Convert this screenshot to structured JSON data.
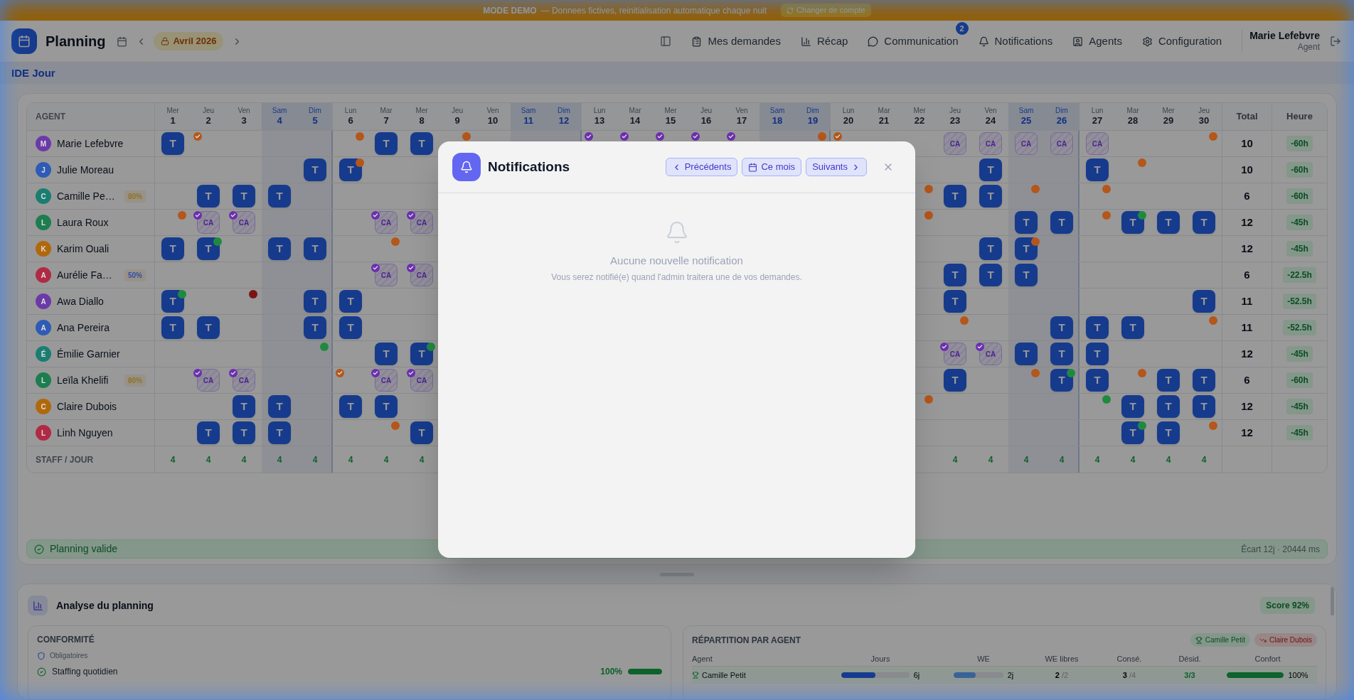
{
  "banner": {
    "label": "MODE DEMO",
    "message": "— Donnees fictives, reinitialisation automatique chaque nuit",
    "button": "Changer de compte"
  },
  "header": {
    "title": "Planning",
    "month": "Avril 2026",
    "nav": [
      {
        "label": "Mes demandes",
        "kind": "requests"
      },
      {
        "label": "Récap",
        "kind": "recap"
      },
      {
        "label": "Communication",
        "kind": "chat",
        "badge": "2"
      },
      {
        "label": "Notifications",
        "kind": "bell"
      },
      {
        "label": "Agents",
        "kind": "agents"
      },
      {
        "label": "Configuration",
        "kind": "settings"
      }
    ],
    "user": {
      "name": "Marie Lefebvre",
      "role": "Agent"
    }
  },
  "team": "IDE Jour",
  "table": {
    "agent_heading": "AGENT",
    "total_heading": "Total",
    "hours_heading": "Heure",
    "footer_label": "STAFF / JOUR",
    "days": [
      {
        "weekday": "Mer",
        "day": "1",
        "weekend": false,
        "staff": "4"
      },
      {
        "weekday": "Jeu",
        "day": "2",
        "weekend": false,
        "staff": "4"
      },
      {
        "weekday": "Ven",
        "day": "3",
        "weekend": false,
        "staff": "4"
      },
      {
        "weekday": "Sam",
        "day": "4",
        "weekend": true,
        "staff": "4"
      },
      {
        "weekday": "Dim",
        "day": "5",
        "weekend": true,
        "staff": "4"
      },
      {
        "weekday": "Lun",
        "day": "6",
        "weekend": false,
        "staff": "4"
      },
      {
        "weekday": "Mar",
        "day": "7",
        "weekend": false,
        "staff": "4"
      },
      {
        "weekday": "Mer",
        "day": "8",
        "weekend": false,
        "staff": "4"
      },
      {
        "weekday": "Jeu",
        "day": "9",
        "weekend": false
      },
      {
        "weekday": "Ven",
        "day": "10",
        "weekend": false
      },
      {
        "weekday": "Sam",
        "day": "11",
        "weekend": true
      },
      {
        "weekday": "Dim",
        "day": "12",
        "weekend": true
      },
      {
        "weekday": "Lun",
        "day": "13",
        "weekend": false
      },
      {
        "weekday": "Mar",
        "day": "14",
        "weekend": false
      },
      {
        "weekday": "Mer",
        "day": "15",
        "weekend": false
      },
      {
        "weekday": "Jeu",
        "day": "16",
        "weekend": false
      },
      {
        "weekday": "Ven",
        "day": "17",
        "weekend": false
      },
      {
        "weekday": "Sam",
        "day": "18",
        "weekend": true
      },
      {
        "weekday": "Dim",
        "day": "19",
        "weekend": true
      },
      {
        "weekday": "Lun",
        "day": "20",
        "weekend": false
      },
      {
        "weekday": "Mar",
        "day": "21",
        "weekend": false
      },
      {
        "weekday": "Mer",
        "day": "22",
        "weekend": false
      },
      {
        "weekday": "Jeu",
        "day": "23",
        "weekend": false,
        "staff": "4"
      },
      {
        "weekday": "Ven",
        "day": "24",
        "weekend": false,
        "staff": "4"
      },
      {
        "weekday": "Sam",
        "day": "25",
        "weekend": true,
        "staff": "4"
      },
      {
        "weekday": "Dim",
        "day": "26",
        "weekend": true,
        "staff": "4"
      },
      {
        "weekday": "Lun",
        "day": "27",
        "weekend": false,
        "staff": "4"
      },
      {
        "weekday": "Mar",
        "day": "28",
        "weekend": false,
        "staff": "4"
      },
      {
        "weekday": "Mer",
        "day": "29",
        "weekend": false,
        "staff": "4"
      },
      {
        "weekday": "Jeu",
        "day": "30",
        "weekend": false,
        "staff": "4"
      }
    ],
    "rows": [
      {
        "initial": "M",
        "color": "#6b3aa8",
        "name": "Marie Lefebvre",
        "total": "10",
        "hours": "-60h",
        "cells": [
          {
            "kind": "shift",
            "label": "T"
          },
          {
            "kind": "empty",
            "marker": {
              "color": "#b5561a",
              "check": true
            }
          },
          {
            "kind": "empty"
          },
          {
            "kind": "empty"
          },
          {
            "kind": "empty"
          },
          {
            "kind": "empty",
            "marker": {
              "color": "#b5561a",
              "check": false
            }
          },
          {
            "kind": "shift",
            "label": "T"
          },
          {
            "kind": "shift",
            "label": "T"
          },
          {
            "kind": "empty",
            "marker": {
              "color": "#b5561a",
              "check": false
            }
          },
          {
            "kind": "empty"
          },
          {
            "kind": "empty"
          },
          {
            "kind": "empty"
          },
          {
            "kind": "empty",
            "marker": {
              "color": "#6b2fb0",
              "check": true
            }
          },
          {
            "kind": "empty",
            "marker": {
              "color": "#6b2fb0",
              "check": true
            }
          },
          {
            "kind": "empty",
            "marker": {
              "color": "#6b2fb0",
              "check": true
            }
          },
          {
            "kind": "empty",
            "marker": {
              "color": "#6b2fb0",
              "check": true
            }
          },
          {
            "kind": "empty",
            "marker": {
              "color": "#6b2fb0",
              "check": true
            }
          },
          {
            "kind": "empty"
          },
          {
            "kind": "empty",
            "marker": {
              "color": "#b5561a",
              "check": false
            }
          },
          {
            "kind": "empty",
            "marker": {
              "color": "#b5561a",
              "check": true
            }
          },
          {
            "kind": "empty"
          },
          {
            "kind": "empty"
          },
          {
            "kind": "leave",
            "label": "CA"
          },
          {
            "kind": "leave",
            "label": "CA"
          },
          {
            "kind": "leave",
            "label": "CA"
          },
          {
            "kind": "leave",
            "label": "CA"
          },
          {
            "kind": "leave",
            "label": "CA"
          },
          {
            "kind": "empty"
          },
          {
            "kind": "empty"
          },
          {
            "kind": "empty",
            "marker": {
              "color": "#b5561a",
              "check": false
            }
          }
        ]
      },
      {
        "initial": "J",
        "color": "#2e5bb5",
        "name": "Julie Moreau",
        "total": "10",
        "hours": "-60h",
        "cells": [
          {
            "kind": "empty"
          },
          {
            "kind": "empty"
          },
          {
            "kind": "empty"
          },
          {
            "kind": "empty"
          },
          {
            "kind": "shift",
            "label": "T"
          },
          {
            "kind": "shift",
            "label": "T",
            "marker": {
              "color": "#b5561a",
              "check": false
            }
          },
          {
            "kind": "empty"
          },
          {
            "kind": "empty"
          },
          {
            "kind": "empty"
          },
          {
            "kind": "empty"
          },
          {
            "kind": "empty"
          },
          {
            "kind": "empty"
          },
          {
            "kind": "empty"
          },
          {
            "kind": "empty"
          },
          {
            "kind": "empty"
          },
          {
            "kind": "empty"
          },
          {
            "kind": "empty"
          },
          {
            "kind": "empty"
          },
          {
            "kind": "empty"
          },
          {
            "kind": "empty"
          },
          {
            "kind": "empty"
          },
          {
            "kind": "empty"
          },
          {
            "kind": "empty"
          },
          {
            "kind": "shift",
            "label": "T"
          },
          {
            "kind": "empty"
          },
          {
            "kind": "empty"
          },
          {
            "kind": "shift",
            "label": "T"
          },
          {
            "kind": "empty",
            "marker": {
              "color": "#b5561a",
              "check": false
            }
          },
          {
            "kind": "empty"
          },
          {
            "kind": "empty"
          }
        ]
      },
      {
        "initial": "C",
        "color": "#1a7d72",
        "name": "Camille Pe…",
        "badge": {
          "label": "80%",
          "color": "#8f7425"
        },
        "total": "6",
        "hours": "-60h",
        "cells": [
          {
            "kind": "empty"
          },
          {
            "kind": "shift",
            "label": "T"
          },
          {
            "kind": "shift",
            "label": "T"
          },
          {
            "kind": "shift",
            "label": "T"
          },
          {
            "kind": "empty"
          },
          {
            "kind": "empty"
          },
          {
            "kind": "empty"
          },
          {
            "kind": "empty"
          },
          {
            "kind": "empty"
          },
          {
            "kind": "empty"
          },
          {
            "kind": "empty"
          },
          {
            "kind": "empty"
          },
          {
            "kind": "empty"
          },
          {
            "kind": "empty"
          },
          {
            "kind": "empty"
          },
          {
            "kind": "empty"
          },
          {
            "kind": "empty"
          },
          {
            "kind": "empty"
          },
          {
            "kind": "empty"
          },
          {
            "kind": "empty"
          },
          {
            "kind": "empty"
          },
          {
            "kind": "empty",
            "marker": {
              "color": "#b5561a",
              "check": false
            }
          },
          {
            "kind": "shift",
            "label": "T"
          },
          {
            "kind": "shift",
            "label": "T"
          },
          {
            "kind": "empty",
            "marker": {
              "color": "#b5561a",
              "check": false
            }
          },
          {
            "kind": "empty"
          },
          {
            "kind": "empty",
            "marker": {
              "color": "#b5561a",
              "check": false
            }
          },
          {
            "kind": "empty"
          },
          {
            "kind": "empty"
          },
          {
            "kind": "empty"
          }
        ]
      },
      {
        "initial": "L",
        "color": "#1d7d4f",
        "name": "Laura Roux",
        "total": "12",
        "hours": "-45h",
        "cells": [
          {
            "kind": "empty",
            "marker": {
              "color": "#b5561a",
              "check": false
            }
          },
          {
            "kind": "leave",
            "label": "CA",
            "marker": {
              "color": "#6b2fb0",
              "check": true
            }
          },
          {
            "kind": "leave",
            "label": "CA",
            "marker": {
              "color": "#6b2fb0",
              "check": true
            }
          },
          {
            "kind": "empty"
          },
          {
            "kind": "empty"
          },
          {
            "kind": "empty"
          },
          {
            "kind": "leave",
            "label": "CA",
            "marker": {
              "color": "#6b2fb0",
              "check": true
            }
          },
          {
            "kind": "leave",
            "label": "CA",
            "marker": {
              "color": "#6b2fb0",
              "check": true
            }
          },
          {
            "kind": "empty"
          },
          {
            "kind": "empty"
          },
          {
            "kind": "empty"
          },
          {
            "kind": "empty"
          },
          {
            "kind": "empty"
          },
          {
            "kind": "empty"
          },
          {
            "kind": "empty"
          },
          {
            "kind": "empty"
          },
          {
            "kind": "empty"
          },
          {
            "kind": "empty"
          },
          {
            "kind": "empty"
          },
          {
            "kind": "empty"
          },
          {
            "kind": "empty"
          },
          {
            "kind": "empty",
            "marker": {
              "color": "#b5561a",
              "check": false
            }
          },
          {
            "kind": "empty"
          },
          {
            "kind": "empty"
          },
          {
            "kind": "shift",
            "label": "T"
          },
          {
            "kind": "shift",
            "label": "T"
          },
          {
            "kind": "empty",
            "marker": {
              "color": "#b5561a",
              "check": false
            }
          },
          {
            "kind": "shift",
            "label": "T",
            "marker": {
              "color": "#1f8a3e",
              "check": false
            }
          },
          {
            "kind": "shift",
            "label": "T"
          },
          {
            "kind": "shift",
            "label": "T"
          }
        ]
      },
      {
        "initial": "K",
        "color": "#b0680c",
        "name": "Karim Ouali",
        "total": "12",
        "hours": "-45h",
        "cells": [
          {
            "kind": "shift",
            "label": "T"
          },
          {
            "kind": "shift",
            "label": "T",
            "marker": {
              "color": "#1f8a3e",
              "check": false
            }
          },
          {
            "kind": "empty"
          },
          {
            "kind": "shift",
            "label": "T"
          },
          {
            "kind": "shift",
            "label": "T"
          },
          {
            "kind": "empty"
          },
          {
            "kind": "empty",
            "marker": {
              "color": "#b5561a",
              "check": false
            }
          },
          {
            "kind": "empty"
          },
          {
            "kind": "empty"
          },
          {
            "kind": "empty"
          },
          {
            "kind": "empty"
          },
          {
            "kind": "empty"
          },
          {
            "kind": "empty"
          },
          {
            "kind": "empty"
          },
          {
            "kind": "empty"
          },
          {
            "kind": "empty"
          },
          {
            "kind": "empty"
          },
          {
            "kind": "empty"
          },
          {
            "kind": "empty"
          },
          {
            "kind": "empty"
          },
          {
            "kind": "empty"
          },
          {
            "kind": "empty"
          },
          {
            "kind": "empty"
          },
          {
            "kind": "shift",
            "label": "T"
          },
          {
            "kind": "shift",
            "label": "T",
            "marker": {
              "color": "#b5561a",
              "check": false
            }
          },
          {
            "kind": "empty"
          },
          {
            "kind": "empty"
          },
          {
            "kind": "empty"
          },
          {
            "kind": "empty"
          },
          {
            "kind": "empty"
          }
        ]
      },
      {
        "initial": "A",
        "color": "#b02a45",
        "name": "Aurélie Fa…",
        "badge": {
          "label": "50%",
          "color": "#2f4fa5"
        },
        "total": "6",
        "hours": "-22.5h",
        "cells": [
          {
            "kind": "empty"
          },
          {
            "kind": "empty"
          },
          {
            "kind": "empty"
          },
          {
            "kind": "empty"
          },
          {
            "kind": "empty"
          },
          {
            "kind": "empty"
          },
          {
            "kind": "leave",
            "label": "CA",
            "marker": {
              "color": "#6b2fb0",
              "check": true
            }
          },
          {
            "kind": "leave",
            "label": "CA",
            "marker": {
              "color": "#6b2fb0",
              "check": true
            }
          },
          {
            "kind": "empty"
          },
          {
            "kind": "empty"
          },
          {
            "kind": "empty"
          },
          {
            "kind": "empty"
          },
          {
            "kind": "empty"
          },
          {
            "kind": "empty"
          },
          {
            "kind": "empty"
          },
          {
            "kind": "empty"
          },
          {
            "kind": "empty"
          },
          {
            "kind": "empty"
          },
          {
            "kind": "empty"
          },
          {
            "kind": "empty"
          },
          {
            "kind": "empty"
          },
          {
            "kind": "empty"
          },
          {
            "kind": "shift",
            "label": "T"
          },
          {
            "kind": "shift",
            "label": "T"
          },
          {
            "kind": "shift",
            "label": "T"
          },
          {
            "kind": "empty"
          },
          {
            "kind": "empty"
          },
          {
            "kind": "empty"
          },
          {
            "kind": "empty"
          },
          {
            "kind": "empty"
          }
        ]
      },
      {
        "initial": "A",
        "color": "#6b3aa8",
        "name": "Awa Diallo",
        "total": "11",
        "hours": "-52.5h",
        "cells": [
          {
            "kind": "shift",
            "label": "T",
            "marker": {
              "color": "#1f8a3e",
              "check": false
            }
          },
          {
            "kind": "empty"
          },
          {
            "kind": "empty",
            "marker": {
              "color": "#7a1414",
              "check": false
            }
          },
          {
            "kind": "empty"
          },
          {
            "kind": "shift",
            "label": "T"
          },
          {
            "kind": "shift",
            "label": "T"
          },
          {
            "kind": "empty"
          },
          {
            "kind": "empty"
          },
          {
            "kind": "empty"
          },
          {
            "kind": "empty"
          },
          {
            "kind": "empty"
          },
          {
            "kind": "empty"
          },
          {
            "kind": "empty"
          },
          {
            "kind": "empty"
          },
          {
            "kind": "empty"
          },
          {
            "kind": "empty"
          },
          {
            "kind": "empty"
          },
          {
            "kind": "empty"
          },
          {
            "kind": "empty"
          },
          {
            "kind": "empty"
          },
          {
            "kind": "empty"
          },
          {
            "kind": "empty"
          },
          {
            "kind": "shift",
            "label": "T"
          },
          {
            "kind": "empty"
          },
          {
            "kind": "empty"
          },
          {
            "kind": "empty"
          },
          {
            "kind": "empty"
          },
          {
            "kind": "empty"
          },
          {
            "kind": "empty"
          },
          {
            "kind": "shift",
            "label": "T"
          }
        ]
      },
      {
        "initial": "A",
        "color": "#2e5bb5",
        "name": "Ana Pereira",
        "total": "11",
        "hours": "-52.5h",
        "cells": [
          {
            "kind": "shift",
            "label": "T"
          },
          {
            "kind": "shift",
            "label": "T"
          },
          {
            "kind": "empty"
          },
          {
            "kind": "empty"
          },
          {
            "kind": "shift",
            "label": "T"
          },
          {
            "kind": "shift",
            "label": "T"
          },
          {
            "kind": "empty"
          },
          {
            "kind": "empty"
          },
          {
            "kind": "empty"
          },
          {
            "kind": "empty"
          },
          {
            "kind": "empty"
          },
          {
            "kind": "empty"
          },
          {
            "kind": "empty"
          },
          {
            "kind": "empty"
          },
          {
            "kind": "empty"
          },
          {
            "kind": "empty"
          },
          {
            "kind": "empty"
          },
          {
            "kind": "empty"
          },
          {
            "kind": "empty"
          },
          {
            "kind": "empty"
          },
          {
            "kind": "empty"
          },
          {
            "kind": "empty"
          },
          {
            "kind": "empty",
            "marker": {
              "color": "#b5561a",
              "check": false
            }
          },
          {
            "kind": "empty"
          },
          {
            "kind": "empty"
          },
          {
            "kind": "shift",
            "label": "T"
          },
          {
            "kind": "shift",
            "label": "T"
          },
          {
            "kind": "shift",
            "label": "T"
          },
          {
            "kind": "empty"
          },
          {
            "kind": "empty",
            "marker": {
              "color": "#b5561a",
              "check": false
            }
          }
        ]
      },
      {
        "initial": "É",
        "color": "#1a7d72",
        "name": "Émilie Garnier",
        "total": "12",
        "hours": "-45h",
        "cells": [
          {
            "kind": "empty"
          },
          {
            "kind": "empty"
          },
          {
            "kind": "empty"
          },
          {
            "kind": "empty"
          },
          {
            "kind": "empty",
            "marker": {
              "color": "#1f8a3e",
              "check": false
            }
          },
          {
            "kind": "empty"
          },
          {
            "kind": "shift",
            "label": "T"
          },
          {
            "kind": "shift",
            "label": "T",
            "marker": {
              "color": "#1f8a3e",
              "check": false
            }
          },
          {
            "kind": "empty"
          },
          {
            "kind": "empty"
          },
          {
            "kind": "empty"
          },
          {
            "kind": "empty"
          },
          {
            "kind": "empty"
          },
          {
            "kind": "empty"
          },
          {
            "kind": "empty"
          },
          {
            "kind": "empty"
          },
          {
            "kind": "empty"
          },
          {
            "kind": "empty"
          },
          {
            "kind": "empty"
          },
          {
            "kind": "empty"
          },
          {
            "kind": "empty"
          },
          {
            "kind": "empty"
          },
          {
            "kind": "leave",
            "label": "CA",
            "marker": {
              "color": "#6b2fb0",
              "check": true
            }
          },
          {
            "kind": "leave",
            "label": "CA",
            "marker": {
              "color": "#6b2fb0",
              "check": true
            }
          },
          {
            "kind": "shift",
            "label": "T"
          },
          {
            "kind": "shift",
            "label": "T"
          },
          {
            "kind": "shift",
            "label": "T"
          },
          {
            "kind": "empty"
          },
          {
            "kind": "empty"
          },
          {
            "kind": "empty"
          }
        ]
      },
      {
        "initial": "L",
        "color": "#1d7d4f",
        "name": "Leïla Khelifi",
        "badge": {
          "label": "80%",
          "color": "#8f7425"
        },
        "total": "6",
        "hours": "-60h",
        "cells": [
          {
            "kind": "empty"
          },
          {
            "kind": "leave",
            "label": "CA",
            "marker": {
              "color": "#6b2fb0",
              "check": true
            }
          },
          {
            "kind": "leave",
            "label": "CA",
            "marker": {
              "color": "#6b2fb0",
              "check": true
            }
          },
          {
            "kind": "empty"
          },
          {
            "kind": "empty"
          },
          {
            "kind": "empty",
            "marker": {
              "color": "#b5561a",
              "check": true
            }
          },
          {
            "kind": "leave",
            "label": "CA",
            "marker": {
              "color": "#6b2fb0",
              "check": true
            }
          },
          {
            "kind": "leave",
            "label": "CA",
            "marker": {
              "color": "#6b2fb0",
              "check": true
            }
          },
          {
            "kind": "empty"
          },
          {
            "kind": "empty"
          },
          {
            "kind": "empty"
          },
          {
            "kind": "empty"
          },
          {
            "kind": "empty"
          },
          {
            "kind": "empty"
          },
          {
            "kind": "empty"
          },
          {
            "kind": "empty"
          },
          {
            "kind": "empty"
          },
          {
            "kind": "empty"
          },
          {
            "kind": "empty"
          },
          {
            "kind": "empty"
          },
          {
            "kind": "empty"
          },
          {
            "kind": "empty"
          },
          {
            "kind": "shift",
            "label": "T"
          },
          {
            "kind": "empty"
          },
          {
            "kind": "empty",
            "marker": {
              "color": "#b5561a",
              "check": false
            }
          },
          {
            "kind": "shift",
            "label": "T",
            "marker": {
              "color": "#1f8a3e",
              "check": false
            }
          },
          {
            "kind": "shift",
            "label": "T"
          },
          {
            "kind": "empty",
            "marker": {
              "color": "#b5561a",
              "check": false
            }
          },
          {
            "kind": "shift",
            "label": "T"
          },
          {
            "kind": "shift",
            "label": "T"
          }
        ]
      },
      {
        "initial": "C",
        "color": "#b0680c",
        "name": "Claire Dubois",
        "total": "12",
        "hours": "-45h",
        "cells": [
          {
            "kind": "empty"
          },
          {
            "kind": "empty"
          },
          {
            "kind": "shift",
            "label": "T"
          },
          {
            "kind": "shift",
            "label": "T"
          },
          {
            "kind": "empty"
          },
          {
            "kind": "shift",
            "label": "T"
          },
          {
            "kind": "shift",
            "label": "T"
          },
          {
            "kind": "empty"
          },
          {
            "kind": "empty"
          },
          {
            "kind": "empty"
          },
          {
            "kind": "empty"
          },
          {
            "kind": "empty"
          },
          {
            "kind": "empty"
          },
          {
            "kind": "empty"
          },
          {
            "kind": "empty"
          },
          {
            "kind": "empty"
          },
          {
            "kind": "empty"
          },
          {
            "kind": "empty"
          },
          {
            "kind": "empty"
          },
          {
            "kind": "empty"
          },
          {
            "kind": "empty"
          },
          {
            "kind": "empty",
            "marker": {
              "color": "#b5561a",
              "check": false
            }
          },
          {
            "kind": "empty"
          },
          {
            "kind": "empty"
          },
          {
            "kind": "empty"
          },
          {
            "kind": "empty"
          },
          {
            "kind": "empty",
            "marker": {
              "color": "#1f8a3e",
              "check": false
            }
          },
          {
            "kind": "shift",
            "label": "T"
          },
          {
            "kind": "shift",
            "label": "T"
          },
          {
            "kind": "shift",
            "label": "T"
          }
        ]
      },
      {
        "initial": "L",
        "color": "#b02a45",
        "name": "Linh Nguyen",
        "total": "12",
        "hours": "-45h",
        "cells": [
          {
            "kind": "empty"
          },
          {
            "kind": "shift",
            "label": "T"
          },
          {
            "kind": "shift",
            "label": "T"
          },
          {
            "kind": "shift",
            "label": "T"
          },
          {
            "kind": "empty"
          },
          {
            "kind": "empty"
          },
          {
            "kind": "empty",
            "marker": {
              "color": "#b5561a",
              "check": false
            }
          },
          {
            "kind": "shift",
            "label": "T"
          },
          {
            "kind": "empty"
          },
          {
            "kind": "empty"
          },
          {
            "kind": "empty"
          },
          {
            "kind": "empty"
          },
          {
            "kind": "empty"
          },
          {
            "kind": "empty"
          },
          {
            "kind": "empty"
          },
          {
            "kind": "empty"
          },
          {
            "kind": "empty"
          },
          {
            "kind": "empty"
          },
          {
            "kind": "empty"
          },
          {
            "kind": "empty"
          },
          {
            "kind": "empty"
          },
          {
            "kind": "empty"
          },
          {
            "kind": "empty"
          },
          {
            "kind": "empty"
          },
          {
            "kind": "empty"
          },
          {
            "kind": "empty"
          },
          {
            "kind": "empty"
          },
          {
            "kind": "shift",
            "label": "T",
            "marker": {
              "color": "#1f8a3e",
              "check": false
            }
          },
          {
            "kind": "shift",
            "label": "T"
          },
          {
            "kind": "empty",
            "marker": {
              "color": "#b5561a",
              "check": false
            }
          }
        ]
      }
    ]
  },
  "status": {
    "label": "Planning valide",
    "detail": "Écart 12j · 20444 ms"
  },
  "analysis": {
    "title": "Analyse du planning",
    "score": "Score 92%",
    "compliance": {
      "title": "CONFORMITÉ",
      "group": "Obligatoires",
      "items": [
        {
          "label": "Staffing quotidien",
          "value": "100%",
          "level": 1
        }
      ]
    },
    "distribution": {
      "title": "RÉPARTITION PAR AGENT",
      "best": "Camille Petit",
      "worst": "Claire Dubois",
      "columns": [
        "Agent",
        "Jours",
        "WE",
        "WE libres",
        "Consé.",
        "Désid.",
        "Confort"
      ],
      "rows": [
        {
          "name": "Camille Petit",
          "days": {
            "text": "6j",
            "level": 0.5
          },
          "weekends": {
            "text": "2j",
            "level": 0.45
          },
          "free_we": "2",
          "free_we_total": "/2",
          "consecutive": "3",
          "consecutive_total": "/4",
          "desired": "3/3",
          "comfort": {
            "text": "100%",
            "level": 1
          }
        }
      ]
    }
  },
  "modal": {
    "title": "Notifications",
    "actions": [
      {
        "label": "Précédents",
        "kind": "prev"
      },
      {
        "label": "Ce mois",
        "kind": "current"
      },
      {
        "label": "Suivants",
        "kind": "next"
      }
    ],
    "empty_title": "Aucune nouvelle notification",
    "empty_text": "Vous serez notifié(e) quand l'admin traitera une de vos demandes."
  }
}
